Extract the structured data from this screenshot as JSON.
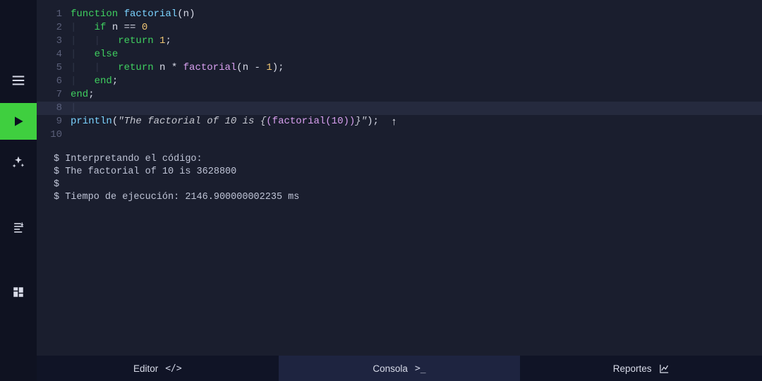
{
  "sidebar": {
    "menu": "menu",
    "run": "run",
    "ai": "ai-assist",
    "sort": "outline",
    "grid": "dashboard"
  },
  "editor": {
    "lines": [
      "1",
      "2",
      "3",
      "4",
      "5",
      "6",
      "7",
      "8",
      "9",
      "10"
    ],
    "l1_kw": "function ",
    "l1_fn": "factorial",
    "l1_open": "(",
    "l1_var": "n",
    "l1_close": ")",
    "l2_kw": "if ",
    "l2_var": "n ",
    "l2_op": "== ",
    "l2_num": "0",
    "l3_kw": "return ",
    "l3_num": "1",
    "l3_semi": ";",
    "l4_kw": "else",
    "l5_kw": "return ",
    "l5_var": "n ",
    "l5_op": "* ",
    "l5_call": "factorial",
    "l5_open": "(",
    "l5_arg": "n ",
    "l5_minus": "- ",
    "l5_num": "1",
    "l5_close": ")",
    "l5_semi": ";",
    "l6_kw": "end",
    "l6_semi": ";",
    "l7_kw": "end",
    "l7_semi": ";",
    "l9_fn": "println",
    "l9_open": "(",
    "l9_str_open": "\"The factorial of 10 is {",
    "l9_call": "(factorial(10))",
    "l9_str_close": "}\"",
    "l9_close": ")",
    "l9_semi": ";"
  },
  "console": {
    "line1": "Interpretando el código:",
    "line2": "The factorial of 10 is 3628800",
    "line3": "",
    "line4": "Tiempo de ejecución: 2146.900000002235 ms"
  },
  "tabs": {
    "editor": "Editor",
    "console": "Consola",
    "reports": "Reportes"
  }
}
